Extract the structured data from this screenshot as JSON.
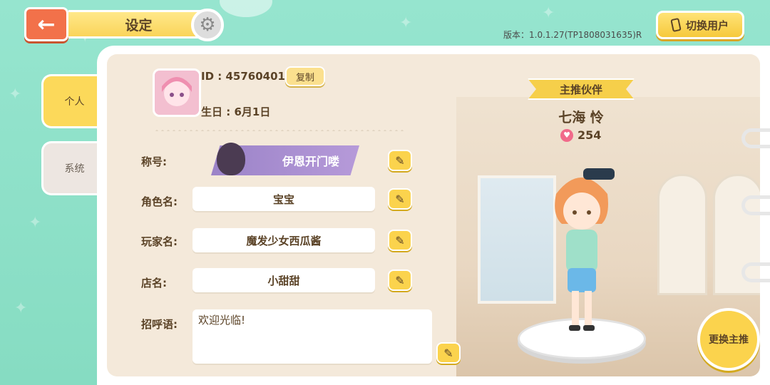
{
  "header": {
    "title": "设定",
    "version": "版本：1.0.1.27(TP1808031635)R",
    "switch_user_label": "切换用户"
  },
  "tabs": [
    {
      "label": "个人",
      "active": true
    },
    {
      "label": "系统",
      "active": false
    }
  ],
  "profile": {
    "id": "ID : 45760401",
    "copy_label": "复制",
    "birthday": "生日 : 6月1日",
    "title_label": "称号:",
    "title_value": "伊恩开门喽",
    "role_label": "角色名:",
    "role_value": "宝宝",
    "player_label": "玩家名:",
    "player_value": "魔发少女西瓜酱",
    "shop_label": "店名:",
    "shop_value": "小甜甜",
    "greeting_label": "招呼语:",
    "greeting_value": "欢迎光临!"
  },
  "partner": {
    "ribbon": "主推伙伴",
    "name": "七海 怜",
    "affection": "254",
    "change_label": "更换主推"
  },
  "icons": {
    "back": "arrow-left-icon",
    "settings": "gear-icon",
    "phone": "phone-icon",
    "edit": "pencil-icon",
    "heart": "heart-icon"
  },
  "colors": {
    "background": "#8fe0c8",
    "accent_yellow": "#fbd34d",
    "back_orange": "#f2714a",
    "text_brown": "#5b4327"
  }
}
